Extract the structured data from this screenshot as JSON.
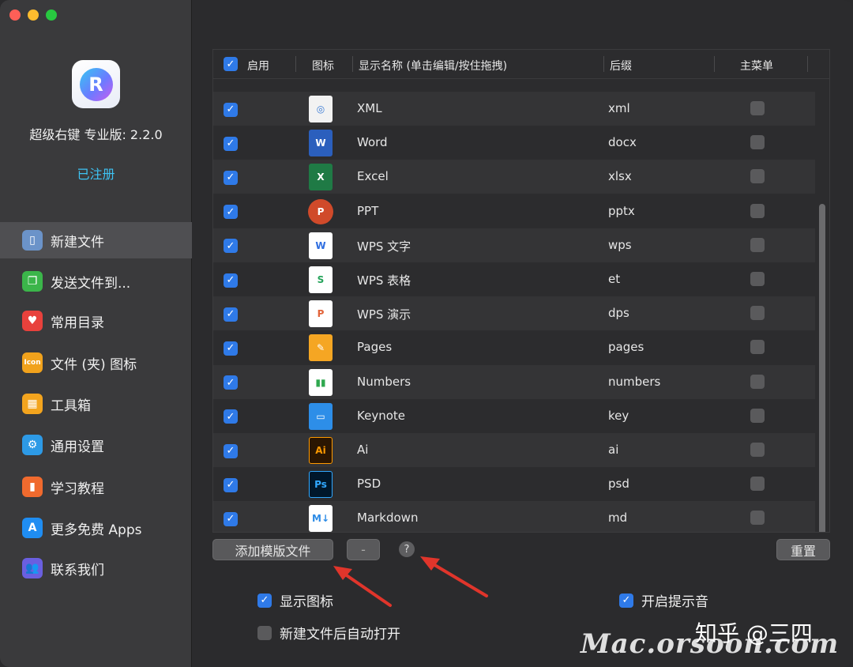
{
  "window": {
    "controls": [
      "close",
      "minimize",
      "zoom"
    ]
  },
  "sidebar": {
    "app_version": "超级右键 专业版: 2.2.0",
    "registered": "已注册",
    "items": [
      {
        "label": "新建文件",
        "icon": "new-file-icon",
        "color": "#6b93c9",
        "active": true
      },
      {
        "label": "发送文件到...",
        "icon": "send-file-icon",
        "color": "#3bb54a"
      },
      {
        "label": "常用目录",
        "icon": "heart-icon",
        "color": "#e8413c"
      },
      {
        "label": "文件 (夹) 图标",
        "icon": "icon-badge-icon",
        "color": "#f1a21c",
        "glyph": "Icon"
      },
      {
        "label": "工具箱",
        "icon": "toolbox-icon",
        "color": "#f3a41e"
      },
      {
        "label": "通用设置",
        "icon": "gear-icon",
        "color": "#2d9ae6"
      },
      {
        "label": "学习教程",
        "icon": "book-icon",
        "color": "#f06a2e"
      },
      {
        "label": "更多免费 Apps",
        "icon": "app-store-icon",
        "color": "#1f8df2"
      },
      {
        "label": "联系我们",
        "icon": "contacts-icon",
        "color": "#6a5fe0"
      }
    ]
  },
  "table": {
    "headers": {
      "enabled": "启用",
      "icon": "图标",
      "name": "显示名称 (单击编辑/按住拖拽)",
      "ext": "后缀",
      "main_menu": "主菜单"
    },
    "rows": [
      {
        "name": "XML",
        "ext": "xml",
        "icon": "xml-file-icon",
        "enabled": true,
        "main_menu": false
      },
      {
        "name": "Word",
        "ext": "docx",
        "icon": "word-icon",
        "enabled": true,
        "main_menu": false
      },
      {
        "name": "Excel",
        "ext": "xlsx",
        "icon": "excel-icon",
        "enabled": true,
        "main_menu": false
      },
      {
        "name": "PPT",
        "ext": "pptx",
        "icon": "powerpoint-icon",
        "enabled": true,
        "main_menu": false
      },
      {
        "name": "WPS 文字",
        "ext": "wps",
        "icon": "wps-writer-icon",
        "enabled": true,
        "main_menu": false
      },
      {
        "name": "WPS 表格",
        "ext": "et",
        "icon": "wps-sheet-icon",
        "enabled": true,
        "main_menu": false
      },
      {
        "name": "WPS 演示",
        "ext": "dps",
        "icon": "wps-presentation-icon",
        "enabled": true,
        "main_menu": false
      },
      {
        "name": "Pages",
        "ext": "pages",
        "icon": "pages-icon",
        "enabled": true,
        "main_menu": false
      },
      {
        "name": "Numbers",
        "ext": "numbers",
        "icon": "numbers-icon",
        "enabled": true,
        "main_menu": false
      },
      {
        "name": "Keynote",
        "ext": "key",
        "icon": "keynote-icon",
        "enabled": true,
        "main_menu": false
      },
      {
        "name": "Ai",
        "ext": "ai",
        "icon": "illustrator-icon",
        "enabled": true,
        "main_menu": false
      },
      {
        "name": "PSD",
        "ext": "psd",
        "icon": "photoshop-icon",
        "enabled": true,
        "main_menu": false
      },
      {
        "name": "Markdown",
        "ext": "md",
        "icon": "markdown-icon",
        "enabled": true,
        "main_menu": false
      }
    ]
  },
  "buttons": {
    "add_template": "添加模版文件",
    "remove": "-",
    "help": "?",
    "reset": "重置"
  },
  "options": {
    "show_icon": {
      "label": "显示图标",
      "checked": true
    },
    "auto_open": {
      "label": "新建文件后自动打开",
      "checked": false
    },
    "sound": {
      "label": "开启提示音",
      "checked": true
    }
  },
  "overlay": {
    "watermark": "Mac.orsoon.com",
    "credit": "知乎 @三四"
  },
  "colors": {
    "accent": "#2f7ae8",
    "registered": "#3ec3f3",
    "arrow": "#e0352b"
  }
}
